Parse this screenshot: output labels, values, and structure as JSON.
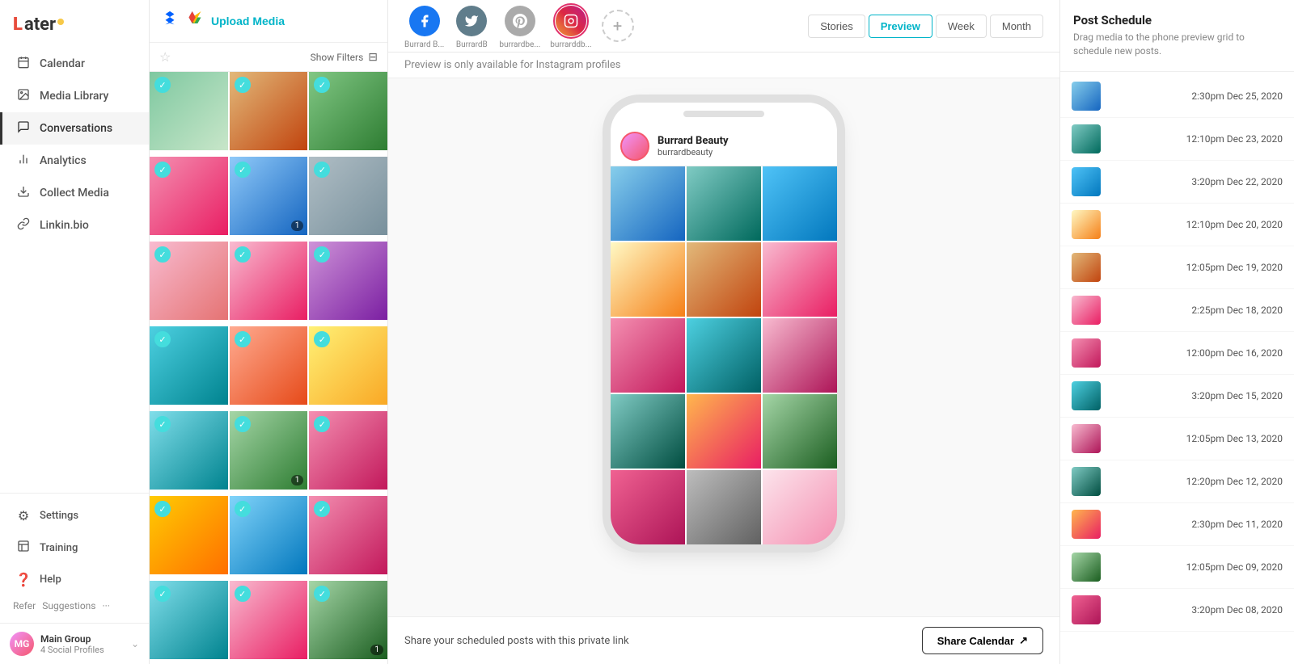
{
  "app": {
    "name": "Later",
    "logo_text": "Later"
  },
  "sidebar": {
    "nav_items": [
      {
        "id": "calendar",
        "label": "Calendar",
        "icon": "📅"
      },
      {
        "id": "media-library",
        "label": "Media Library",
        "icon": "🖼"
      },
      {
        "id": "conversations",
        "label": "Conversations",
        "icon": "💬"
      },
      {
        "id": "analytics",
        "label": "Analytics",
        "icon": "📊"
      },
      {
        "id": "collect-media",
        "label": "Collect Media",
        "icon": "⬇"
      },
      {
        "id": "linkin-bio",
        "label": "Linkin.bio",
        "icon": "🔗"
      }
    ],
    "bottom_items": [
      {
        "id": "settings",
        "label": "Settings",
        "icon": "⚙"
      },
      {
        "id": "training",
        "label": "Training",
        "icon": "📋"
      },
      {
        "id": "help",
        "label": "Help",
        "icon": "❓"
      }
    ],
    "extras": [
      "Refer",
      "Suggestions",
      "···"
    ],
    "workspace": {
      "name": "Main Group",
      "sub": "4 Social Profiles"
    }
  },
  "media_panel": {
    "upload_label": "Upload Media",
    "filter_label": "Show Filters",
    "items": [
      {
        "id": 1,
        "color": "c-avocado",
        "checked": true
      },
      {
        "id": 2,
        "color": "c-desert",
        "checked": true,
        "count": null
      },
      {
        "id": 3,
        "color": "c-cactus",
        "checked": true
      },
      {
        "id": 4,
        "color": "c-pink",
        "checked": true
      },
      {
        "id": 5,
        "color": "c-ferris",
        "checked": true,
        "count": "1"
      },
      {
        "id": 6,
        "color": "c-woman",
        "checked": true
      },
      {
        "id": 7,
        "color": "c-building",
        "checked": true
      },
      {
        "id": 8,
        "color": "c-flowers",
        "checked": true
      },
      {
        "id": 9,
        "color": "c-purple",
        "checked": true
      },
      {
        "id": 10,
        "color": "c-teal",
        "checked": true
      },
      {
        "id": 11,
        "color": "c-orange-swirl",
        "checked": true
      },
      {
        "id": 12,
        "color": "c-pineapple",
        "checked": true
      },
      {
        "id": 13,
        "color": "c-beach",
        "checked": true
      },
      {
        "id": 14,
        "color": "c-palm",
        "checked": true,
        "count": "1"
      },
      {
        "id": 15,
        "color": "c-pink-build",
        "checked": true
      },
      {
        "id": 16,
        "color": "c-umbrellas",
        "checked": true
      },
      {
        "id": 17,
        "color": "c-sky",
        "checked": true
      },
      {
        "id": 18,
        "color": "c-pink-flow",
        "checked": true
      },
      {
        "id": 19,
        "color": "c-balloon",
        "checked": true
      },
      {
        "id": 20,
        "color": "c-green-leaf",
        "checked": true
      },
      {
        "id": 21,
        "color": "c-pink-flow",
        "checked": true,
        "count": "1"
      }
    ]
  },
  "top_nav": {
    "profiles": [
      {
        "id": "burrard-b1",
        "label": "Burrard B...",
        "color": "#1877f2",
        "icon": "f"
      },
      {
        "id": "burrard-b2",
        "label": "BurrardB",
        "color": "#1da1f2",
        "icon": "t"
      },
      {
        "id": "burrardbe",
        "label": "burrardbe...",
        "color": "#e1306c",
        "icon": "p"
      },
      {
        "id": "burrarddb",
        "label": "burrarddb...",
        "color": "#e1306c",
        "icon": "ig",
        "active": true
      }
    ],
    "view_tabs": [
      {
        "id": "stories",
        "label": "Stories"
      },
      {
        "id": "preview",
        "label": "Preview",
        "active": true
      },
      {
        "id": "week",
        "label": "Week"
      },
      {
        "id": "month",
        "label": "Month"
      }
    ]
  },
  "preview": {
    "notice": "Preview is only available for Instagram profiles",
    "profile_name": "Burrard Beauty",
    "profile_handle": "burrardbeauty",
    "grid_colors": [
      "c-blue-sky",
      "c-green-car",
      "c-teal-palm",
      "c-icecream",
      "c-desert",
      "c-pink-arch",
      "c-pink-flowers",
      "c-teal-bird",
      "c-pink-wall",
      "c-cactus2",
      "c-sunset",
      "c-green-lines",
      "c-hotpink",
      "c-gray-wall",
      "c-light-pink"
    ],
    "share_text": "Share your scheduled posts with this private link",
    "share_btn": "Share Calendar"
  },
  "schedule": {
    "title": "Post Schedule",
    "description": "Drag media to the phone preview grid to schedule new posts.",
    "items": [
      {
        "time": "2:30pm Dec 25, 2020",
        "color": "c-blue-sky"
      },
      {
        "time": "12:10pm Dec 23, 2020",
        "color": "c-green-car"
      },
      {
        "time": "3:20pm Dec 22, 2020",
        "color": "c-teal-palm"
      },
      {
        "time": "12:10pm Dec 20, 2020",
        "color": "c-icecream"
      },
      {
        "time": "12:05pm Dec 19, 2020",
        "color": "c-desert"
      },
      {
        "time": "2:25pm Dec 18, 2020",
        "color": "c-pink-arch"
      },
      {
        "time": "12:00pm Dec 16, 2020",
        "color": "c-pink-flowers"
      },
      {
        "time": "3:20pm Dec 15, 2020",
        "color": "c-teal-bird"
      },
      {
        "time": "12:05pm Dec 13, 2020",
        "color": "c-pink-wall"
      },
      {
        "time": "12:20pm Dec 12, 2020",
        "color": "c-cactus2"
      },
      {
        "time": "2:30pm Dec 11, 2020",
        "color": "c-sunset"
      },
      {
        "time": "12:05pm Dec 09, 2020",
        "color": "c-green-lines"
      },
      {
        "time": "3:20pm Dec 08, 2020",
        "color": "c-hotpink"
      }
    ]
  }
}
